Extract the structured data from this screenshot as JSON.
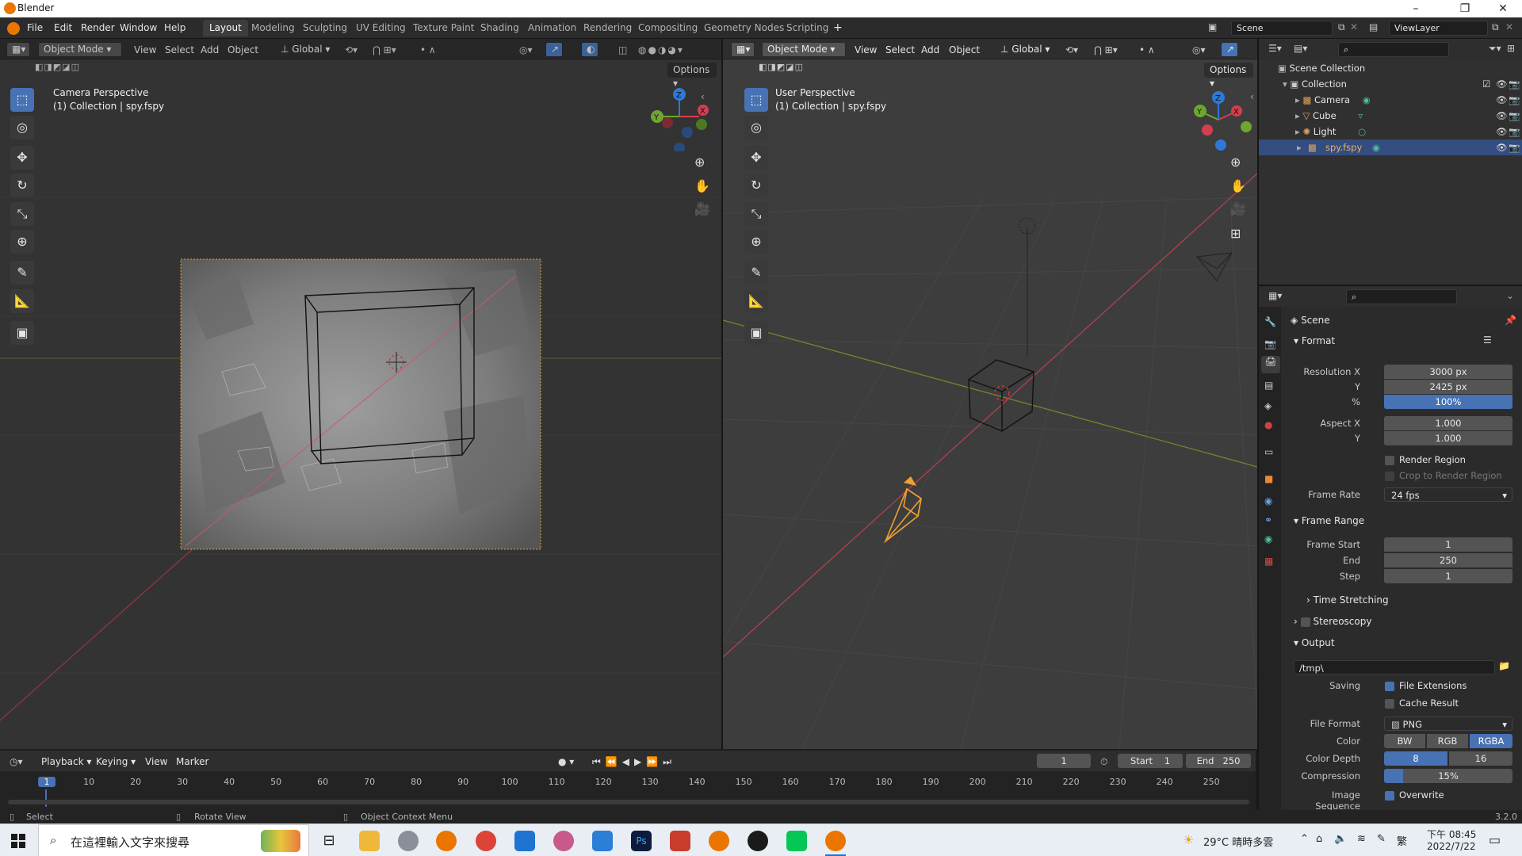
{
  "window": {
    "title": "Blender",
    "min": "–",
    "max": "❐",
    "close": "✕"
  },
  "menu": [
    "File",
    "Edit",
    "Render",
    "Window",
    "Help"
  ],
  "workspaces": [
    "Layout",
    "Modeling",
    "Sculpting",
    "UV Editing",
    "Texture Paint",
    "Shading",
    "Animation",
    "Rendering",
    "Compositing",
    "Geometry Nodes",
    "Scripting"
  ],
  "workspace_add": "+",
  "scene_field": "Scene",
  "viewlayer_field": "ViewLayer",
  "vp_left": {
    "mode": "Object Mode",
    "menus": [
      "View",
      "Select",
      "Add",
      "Object"
    ],
    "orientation": "Global",
    "options": "Options",
    "perspective": "Camera Perspective",
    "collection": "(1) Collection | spy.fspy"
  },
  "vp_right": {
    "mode": "Object Mode",
    "menus": [
      "View",
      "Select",
      "Add",
      "Object"
    ],
    "orientation": "Global",
    "options": "Options",
    "perspective": "User Perspective",
    "collection": "(1) Collection | spy.fspy"
  },
  "gizmo": {
    "x": "X",
    "y": "Y",
    "z": "Z"
  },
  "outliner": {
    "root": "Scene Collection",
    "collection": "Collection",
    "items": [
      {
        "label": "Camera",
        "color": "#e0a35a"
      },
      {
        "label": "Cube",
        "color": "#e0a35a"
      },
      {
        "label": "Light",
        "color": "#e0a35a"
      },
      {
        "label": "spy.fspy",
        "color": "#e0a35a"
      }
    ]
  },
  "properties": {
    "title": "Scene",
    "format_header": "Format",
    "resx_label": "Resolution X",
    "resx": "3000 px",
    "resy_label": "Y",
    "resy": "2425 px",
    "pct_label": "%",
    "pct": "100%",
    "aspx_label": "Aspect X",
    "aspx": "1.000",
    "aspy_label": "Y",
    "aspy": "1.000",
    "render_region": "Render Region",
    "crop_region": "Crop to Render Region",
    "framerate_label": "Frame Rate",
    "framerate": "24 fps",
    "framerange_header": "Frame Range",
    "fstart_label": "Frame Start",
    "fstart": "1",
    "fend_label": "End",
    "fend": "250",
    "fstep_label": "Step",
    "fstep": "1",
    "timestretch": "Time Stretching",
    "stereoscopy": "Stereoscopy",
    "output_header": "Output",
    "output_path": "/tmp\\",
    "saving_label": "Saving",
    "file_ext": "File Extensions",
    "cache_result": "Cache Result",
    "fileformat_label": "File Format",
    "fileformat": "PNG",
    "color_label": "Color",
    "color_bw": "BW",
    "color_rgb": "RGB",
    "color_rgba": "RGBA",
    "depth_label": "Color Depth",
    "depth8": "8",
    "depth16": "16",
    "compression_label": "Compression",
    "compression": "15%",
    "imgseq_label": "Image Sequence",
    "overwrite": "Overwrite"
  },
  "timeline": {
    "menus": [
      "Playback",
      "Keying",
      "View",
      "Marker"
    ],
    "current_frame": "1",
    "start_label": "Start",
    "start": "1",
    "end_label": "End",
    "end": "250",
    "ticks": [
      "1",
      "10",
      "20",
      "30",
      "40",
      "50",
      "60",
      "70",
      "80",
      "90",
      "100",
      "110",
      "120",
      "130",
      "140",
      "150",
      "160",
      "170",
      "180",
      "190",
      "200",
      "210",
      "220",
      "230",
      "240",
      "250"
    ]
  },
  "status": {
    "select": "Select",
    "rotate": "Rotate View",
    "context": "Object Context Menu",
    "version": "3.2.0"
  },
  "taskbar": {
    "search_placeholder": "在這裡輸入文字來搜尋",
    "weather": "29°C 晴時多雲",
    "ime": "繁",
    "time": "下午 08:45",
    "date": "2022/7/22"
  }
}
